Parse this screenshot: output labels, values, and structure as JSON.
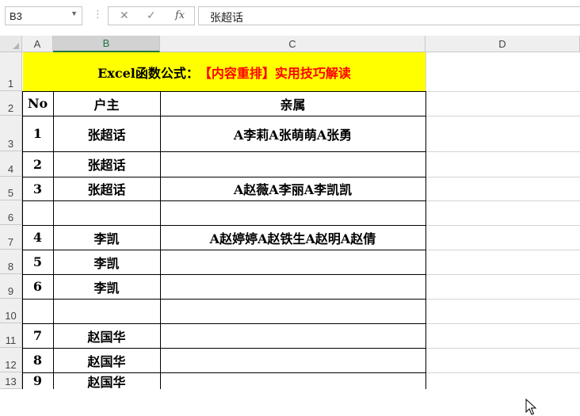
{
  "formula_bar": {
    "name_box": "B3",
    "formula": "张超话",
    "cancel_icon": "✕",
    "enter_icon": "✓",
    "fx_icon": "fx"
  },
  "columns": [
    "A",
    "B",
    "C",
    "D"
  ],
  "rows": [
    "1",
    "2",
    "3",
    "4",
    "5",
    "6",
    "7",
    "8",
    "9",
    "10",
    "11",
    "12",
    "13"
  ],
  "title": {
    "prefix": "Excel函数公式：",
    "highlight": "【内容重排】实用技巧解读"
  },
  "headers": {
    "no": "No",
    "householder": "户主",
    "relatives": "亲属"
  },
  "table": [
    {
      "no": "1",
      "householder": "张超话",
      "relatives": "A李莉A张萌萌A张勇"
    },
    {
      "no": "2",
      "householder": "张超话",
      "relatives": ""
    },
    {
      "no": "3",
      "householder": "张超话",
      "relatives": "A赵薇A李丽A李凯凯"
    },
    {
      "no": "",
      "householder": "",
      "relatives": ""
    },
    {
      "no": "4",
      "householder": "李凯",
      "relatives": "A赵婷婷A赵铁生A赵明A赵倩"
    },
    {
      "no": "5",
      "householder": "李凯",
      "relatives": ""
    },
    {
      "no": "6",
      "householder": "李凯",
      "relatives": ""
    },
    {
      "no": "",
      "householder": "",
      "relatives": ""
    },
    {
      "no": "7",
      "householder": "赵国华",
      "relatives": ""
    },
    {
      "no": "8",
      "householder": "赵国华",
      "relatives": ""
    },
    {
      "no": "9",
      "householder": "赵国华",
      "relatives": ""
    }
  ],
  "colors": {
    "title_bg": "#ffff00",
    "title_red": "#ff0000",
    "excel_green": "#217346"
  }
}
